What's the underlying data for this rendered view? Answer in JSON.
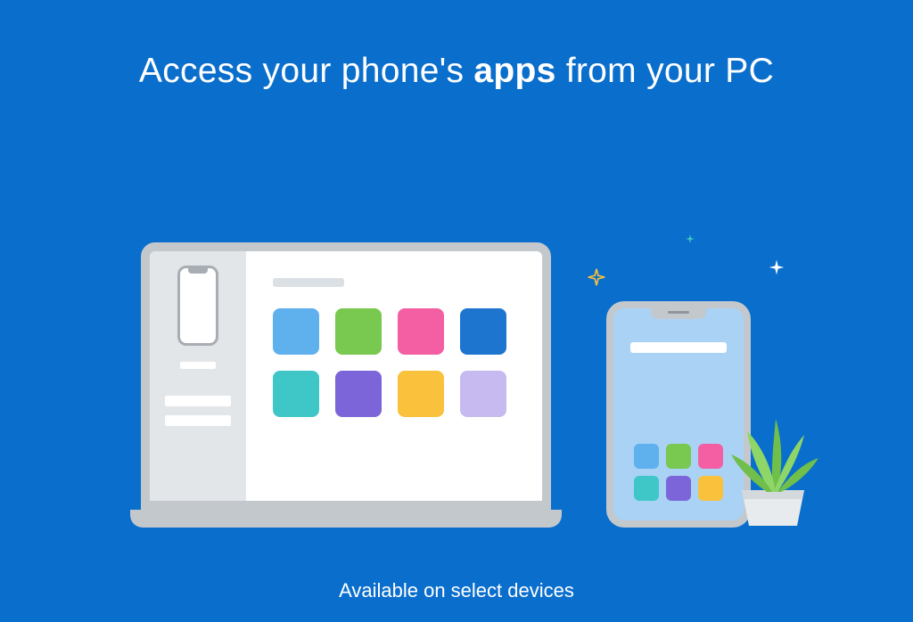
{
  "headline": {
    "pre": "Access your phone's ",
    "bold": "apps",
    "post": " from your PC"
  },
  "footer": "Available on select devices",
  "colors": {
    "tile_blue_light": "#5fb1ee",
    "tile_green": "#79c850",
    "tile_pink": "#f35fa2",
    "tile_blue_dark": "#1e75cf",
    "tile_teal": "#3fc7c7",
    "tile_purple": "#7c65d9",
    "tile_yellow": "#f9c13c",
    "tile_lavender": "#c6baf0"
  },
  "laptop_tiles": [
    "tile_blue_light",
    "tile_green",
    "tile_pink",
    "tile_blue_dark",
    "tile_teal",
    "tile_purple",
    "tile_yellow",
    "tile_lavender"
  ],
  "phone_tiles": [
    "tile_blue_light",
    "tile_green",
    "tile_pink",
    "tile_teal",
    "tile_purple",
    "tile_yellow"
  ]
}
